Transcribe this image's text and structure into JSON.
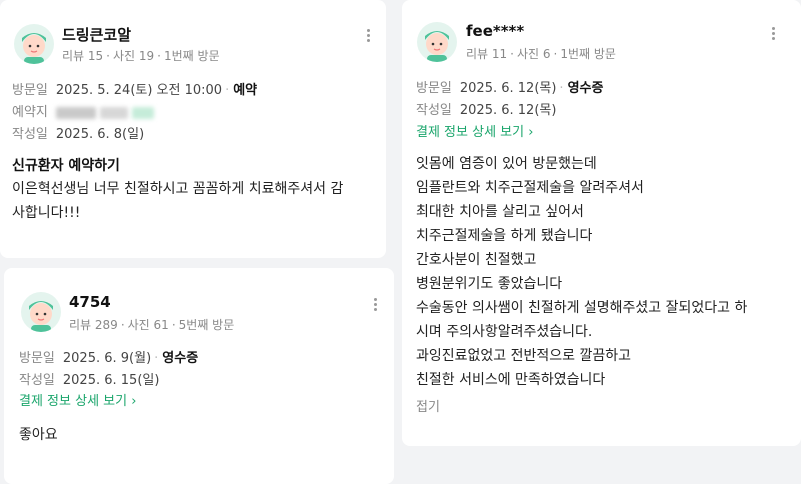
{
  "reviews": [
    {
      "nickname": "드링큰코알",
      "stats": {
        "reviews": "리뷰 15",
        "photos": "사진 19",
        "visit_count": "1번째 방문"
      },
      "visit": {
        "label": "방문일",
        "date": "2025. 5. 24(토) 오전 10:00",
        "badge": "예약"
      },
      "reservation": {
        "label": "예약지"
      },
      "written": {
        "label": "작성일",
        "date": "2025. 6. 8(일)"
      },
      "title": "신규환자 예약하기",
      "body_lines": [
        "이은혁선생님 너무 친절하시고 꼼꼼하게 치료해주셔서 감",
        "사합니다!!!"
      ]
    },
    {
      "nickname": "4754",
      "stats": {
        "reviews": "리뷰 289",
        "photos": "사진 61",
        "visit_count": "5번째 방문"
      },
      "visit": {
        "label": "방문일",
        "date": "2025. 6. 9(월)",
        "badge": "영수증"
      },
      "written": {
        "label": "작성일",
        "date": "2025. 6. 15(일)"
      },
      "payment_link": "결제 정보 상세 보기",
      "body_lines": [
        "좋아요"
      ]
    },
    {
      "nickname": "fee****",
      "stats": {
        "reviews": "리뷰 11",
        "photos": "사진 6",
        "visit_count": "1번째 방문"
      },
      "visit": {
        "label": "방문일",
        "date": "2025. 6. 12(목)",
        "badge": "영수증"
      },
      "written": {
        "label": "작성일",
        "date": "2025. 6. 12(목)"
      },
      "payment_link": "결제 정보 상세 보기",
      "body_lines": [
        "잇몸에 염증이 있어 방문했는데",
        "임플란트와 치주근절제술을 알려주셔서",
        "최대한 치아를 살리고 싶어서",
        "치주근절제술을 하게 됐습니다",
        "간호사분이 친절했고",
        "병원분위기도 좋았습니다",
        "수술동안 의사쌤이 친절하게 설명해주셨고 잘되었다고 하",
        "시며 주의사항알려주셨습니다.",
        "과잉진료없었고 전반적으로 깔끔하고",
        "친절한 서비스에 만족하였습니다"
      ],
      "fold_label": "접기"
    }
  ],
  "colors": {
    "accent": "#1aa56b",
    "muted": "#888888",
    "avatar_bg": "#e4f4ee"
  },
  "icons": {
    "more": "more-vertical-icon",
    "avatar": "user-avatar-icon",
    "chevron": "chevron-right-icon"
  }
}
